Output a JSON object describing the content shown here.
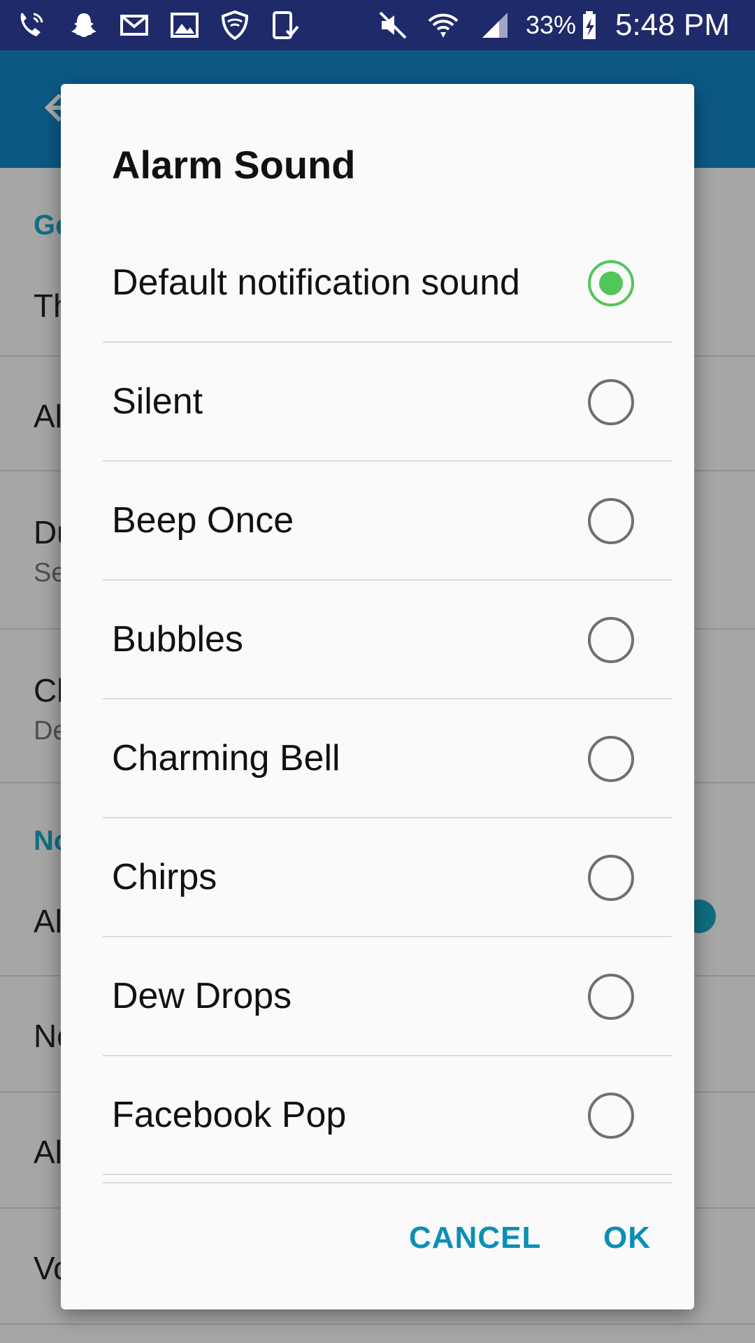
{
  "status_bar": {
    "battery_percent": "33%",
    "time": "5:48 PM",
    "icons": [
      "wifi-calling-icon",
      "snapchat-icon",
      "mail-icon",
      "image-icon",
      "vpn-shield-icon",
      "device-check-icon",
      "mute-icon",
      "wifi-icon",
      "signal-icon",
      "battery-charging-icon"
    ]
  },
  "app_bar": {
    "color": "#1383c6",
    "back_icon": "arrow-back-icon"
  },
  "settings_behind": {
    "sections": [
      "Ge",
      "No"
    ],
    "rows": [
      {
        "title": "Th"
      },
      {
        "title": "Al"
      },
      {
        "title": "Du",
        "subtitle": "Se"
      },
      {
        "title": "Cl",
        "subtitle": "De"
      },
      {
        "title": "Al"
      },
      {
        "title": "No"
      },
      {
        "title": "Al"
      },
      {
        "title": "Vo"
      }
    ]
  },
  "dialog": {
    "title": "Alarm Sound",
    "options": [
      {
        "label": "Default notification sound",
        "selected": true
      },
      {
        "label": "Silent",
        "selected": false
      },
      {
        "label": "Beep Once",
        "selected": false
      },
      {
        "label": "Bubbles",
        "selected": false
      },
      {
        "label": "Charming Bell",
        "selected": false
      },
      {
        "label": "Chirps",
        "selected": false
      },
      {
        "label": "Dew Drops",
        "selected": false
      },
      {
        "label": "Facebook Pop",
        "selected": false
      }
    ],
    "cancel_label": "CANCEL",
    "ok_label": "OK",
    "accent_color": "#52c65b",
    "button_color": "#0b8fb5"
  }
}
